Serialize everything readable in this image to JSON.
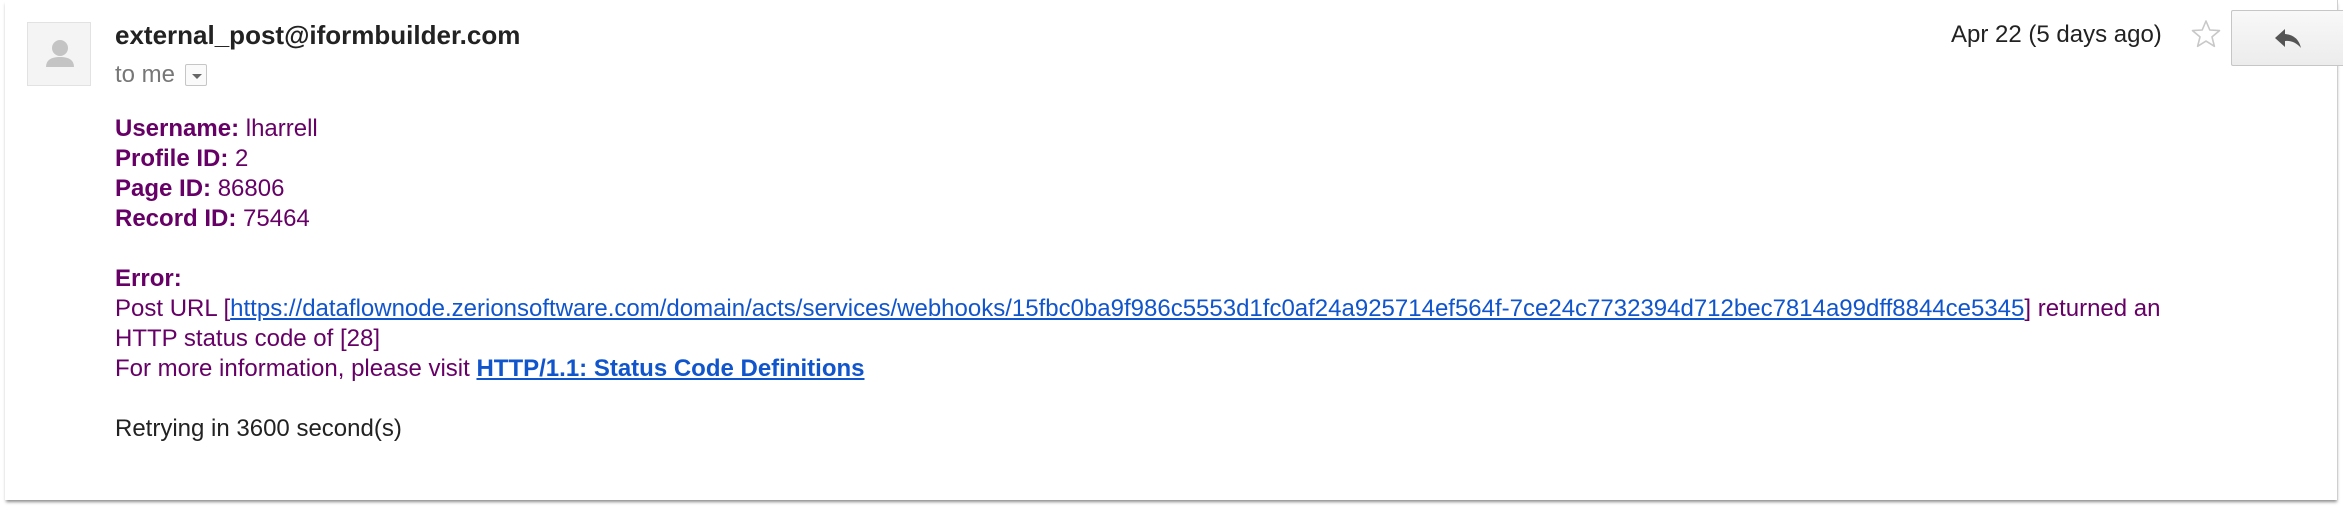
{
  "email": {
    "sender": "external_post@iformbuilder.com",
    "to_label": "to me",
    "date": "Apr 22 (5 days ago)",
    "icons": {
      "avatar": "default-avatar-icon",
      "details": "chevron-down-icon",
      "star": "star-outline-icon",
      "reply": "reply-arrow-icon"
    }
  },
  "body": {
    "username_label": "Username:",
    "username_value": " lharrell",
    "profile_label": "Profile ID:",
    "profile_value": " 2",
    "page_label": "Page ID:",
    "page_value": " 86806",
    "record_label": "Record ID:",
    "record_value": " 75464",
    "error_label": "Error:",
    "post_url_prefix": "Post URL [",
    "post_url": "https://dataflownode.zerionsoftware.com/domain/acts/services/webhooks/15fbc0ba9f986c5553d1fc0af24a925714ef564f-7ce24c7732394d712bec7814a99dff8844ce5345",
    "post_url_suffix": "] returned an",
    "status_line": "HTTP status code of [28]",
    "more_info_prefix": "For more information, please visit ",
    "more_info_link": "HTTP/1.1: Status Code Definitions",
    "retry_text": "Retrying in 3600 second(s)"
  },
  "colors": {
    "body_text": "#660066",
    "link": "#1155cc",
    "sender": "#222222",
    "muted": "#777777"
  }
}
